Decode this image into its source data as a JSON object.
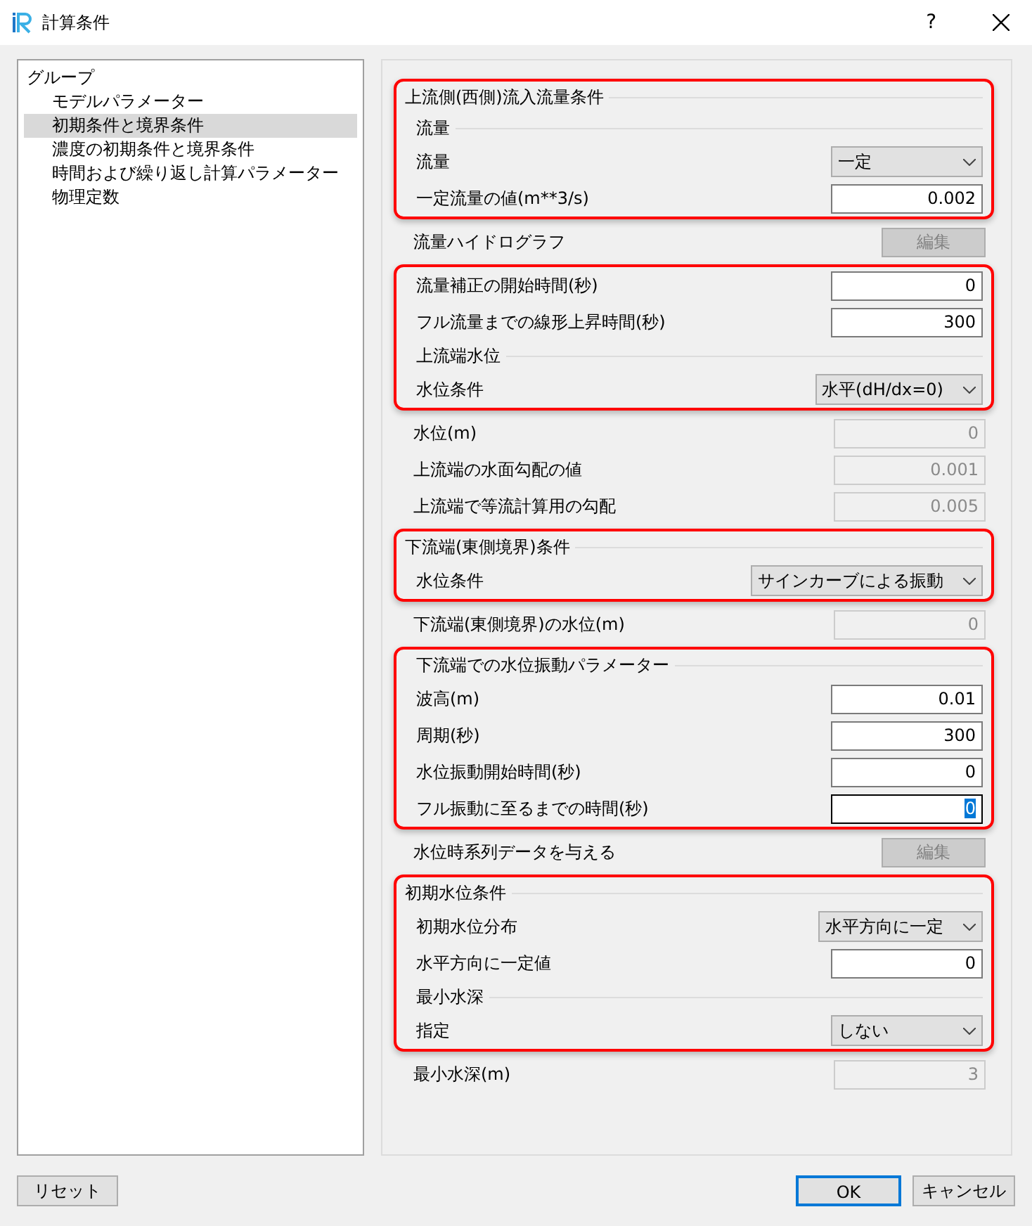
{
  "window": {
    "title": "計算条件",
    "help": "?"
  },
  "sidebar": {
    "header": "グループ",
    "items": [
      {
        "label": "モデルパラメーター",
        "selected": false
      },
      {
        "label": "初期条件と境界条件",
        "selected": true
      },
      {
        "label": "濃度の初期条件と境界条件",
        "selected": false
      },
      {
        "label": "時間および繰り返し計算パラメーター",
        "selected": false
      },
      {
        "label": "物理定数",
        "selected": false
      }
    ]
  },
  "rows": [
    {
      "kind": "group-title",
      "label": "上流側(西側)流入流量条件",
      "highlighted": true
    },
    {
      "kind": "subgroup-title",
      "label": "流量",
      "highlighted": true
    },
    {
      "kind": "select",
      "label": "流量",
      "value": "一定",
      "highlighted": true
    },
    {
      "kind": "input",
      "label": "一定流量の値(m**3/s)",
      "value": "0.002",
      "disabled": false,
      "highlighted": true
    },
    {
      "kind": "button",
      "label": "流量ハイドログラフ",
      "value": "編集",
      "disabled": true,
      "highlighted": false
    },
    {
      "kind": "input",
      "label": "流量補正の開始時間(秒)",
      "value": "0",
      "disabled": false,
      "highlighted": true
    },
    {
      "kind": "input",
      "label": "フル流量までの線形上昇時間(秒)",
      "value": "300",
      "disabled": false,
      "highlighted": true
    },
    {
      "kind": "subgroup-title",
      "label": "上流端水位",
      "highlighted": true
    },
    {
      "kind": "select",
      "label": "水位条件",
      "value": "水平(dH/dx=0)",
      "highlighted": true
    },
    {
      "kind": "input",
      "label": "水位(m)",
      "value": "0",
      "disabled": true,
      "highlighted": false
    },
    {
      "kind": "input",
      "label": "上流端の水面勾配の値",
      "value": "0.001",
      "disabled": true,
      "highlighted": false
    },
    {
      "kind": "input",
      "label": "上流端で等流計算用の勾配",
      "value": "0.005",
      "disabled": true,
      "highlighted": false
    },
    {
      "kind": "group-title",
      "label": "下流端(東側境界)条件",
      "highlighted": true
    },
    {
      "kind": "select",
      "label": "水位条件",
      "value": "サインカーブによる振動",
      "highlighted": true
    },
    {
      "kind": "input",
      "label": "下流端(東側境界)の水位(m)",
      "value": "0",
      "disabled": true,
      "highlighted": false
    },
    {
      "kind": "subgroup-title",
      "label": "下流端での水位振動パラメーター",
      "highlighted": true
    },
    {
      "kind": "input",
      "label": "波高(m)",
      "value": "0.01",
      "disabled": false,
      "highlighted": true
    },
    {
      "kind": "input",
      "label": "周期(秒)",
      "value": "300",
      "disabled": false,
      "highlighted": true
    },
    {
      "kind": "input",
      "label": "水位振動開始時間(秒)",
      "value": "0",
      "disabled": false,
      "highlighted": true
    },
    {
      "kind": "input",
      "label": "フル振動に至るまでの時間(秒)",
      "value": "0",
      "disabled": false,
      "focused": true,
      "highlighted": true
    },
    {
      "kind": "button",
      "label": "水位時系列データを与える",
      "value": "編集",
      "disabled": true,
      "highlighted": false
    },
    {
      "kind": "group-title",
      "label": "初期水位条件",
      "highlighted": true
    },
    {
      "kind": "select",
      "label": "初期水位分布",
      "value": "水平方向に一定",
      "highlighted": true
    },
    {
      "kind": "input",
      "label": "水平方向に一定値",
      "value": "0",
      "disabled": false,
      "highlighted": true
    },
    {
      "kind": "subgroup-title",
      "label": "最小水深",
      "highlighted": true
    },
    {
      "kind": "select",
      "label": "指定",
      "value": "しない",
      "highlighted": true
    },
    {
      "kind": "input",
      "label": "最小水深(m)",
      "value": "3",
      "disabled": true,
      "highlighted": false
    }
  ],
  "footer": {
    "reset": "リセット",
    "ok": "OK",
    "cancel": "キャンセル"
  }
}
